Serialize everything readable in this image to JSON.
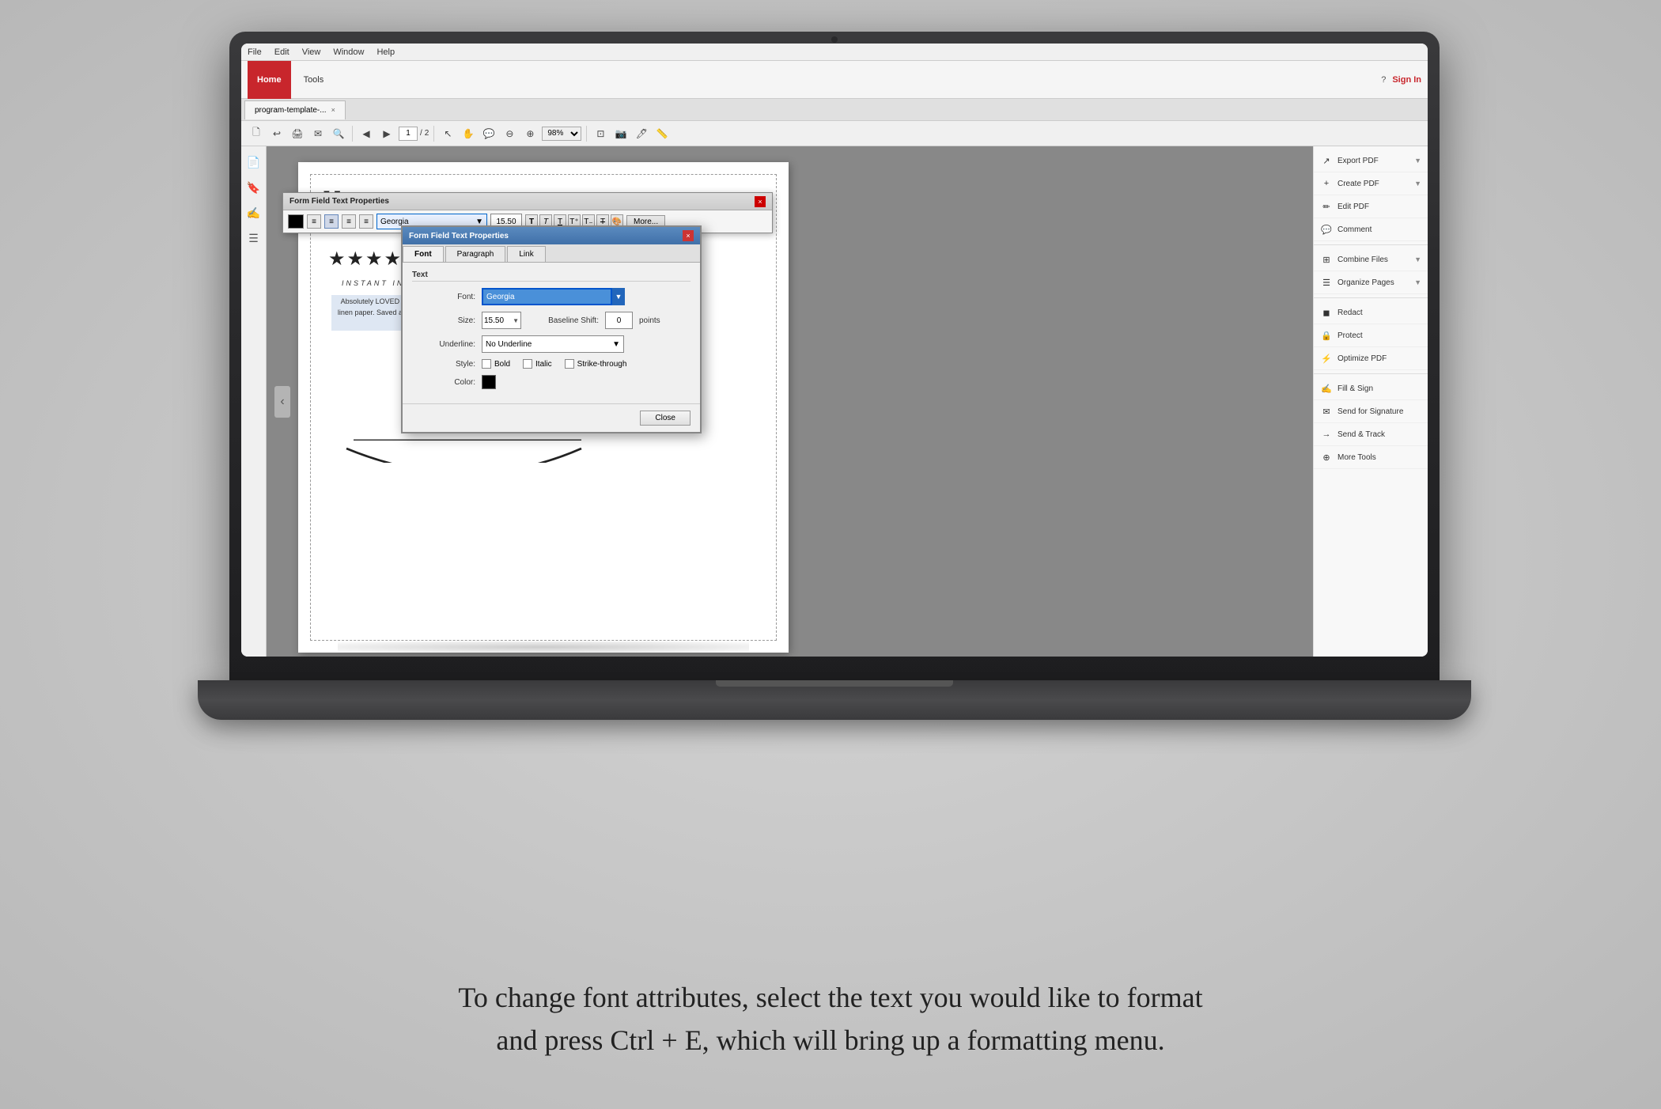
{
  "background": {
    "color": "#c8c8c8"
  },
  "menu_bar": {
    "items": [
      "File",
      "Edit",
      "View",
      "Window",
      "Help"
    ]
  },
  "ribbon": {
    "home_tab": "Home",
    "tools_tab": "Tools",
    "tab_label": "program-template-...",
    "sign_in": "Sign In",
    "help_icon": "?"
  },
  "toolbar": {
    "page_current": "1",
    "page_total": "2",
    "zoom": "98%"
  },
  "right_panel": {
    "items": [
      {
        "label": "Export PDF",
        "icon": "↗",
        "has_arrow": true
      },
      {
        "label": "Create PDF",
        "icon": "+",
        "has_arrow": true
      },
      {
        "label": "Edit PDF",
        "icon": "✏",
        "has_arrow": false
      },
      {
        "label": "Comment",
        "icon": "💬",
        "has_arrow": false
      },
      {
        "label": "Combine Files",
        "icon": "⊞",
        "has_arrow": true
      },
      {
        "label": "Organize Pages",
        "icon": "☰",
        "has_arrow": true
      },
      {
        "label": "Redact",
        "icon": "◼",
        "has_arrow": false
      },
      {
        "label": "Protect",
        "icon": "🔒",
        "has_arrow": false
      },
      {
        "label": "Optimize PDF",
        "icon": "⚡",
        "has_arrow": false
      },
      {
        "label": "Fill & Sign",
        "icon": "✍",
        "has_arrow": false
      },
      {
        "label": "Send for Signature",
        "icon": "✉",
        "has_arrow": false
      },
      {
        "label": "Send & Track",
        "icon": "→",
        "has_arrow": false
      },
      {
        "label": "More Tools",
        "icon": "⊕",
        "has_arrow": false
      }
    ]
  },
  "form_field_dialog_top": {
    "title": "Form Field Text Properties",
    "font": "Georgia",
    "size": "15.50",
    "more_btn": "More..."
  },
  "form_field_dialog_main": {
    "title": "Form Field Text Properties",
    "tabs": [
      "Font",
      "Paragraph",
      "Link"
    ],
    "active_tab": "Font",
    "text_section": "Text",
    "font_label": "Font:",
    "font_value": "Georgia",
    "size_label": "Size:",
    "size_value": "15.50",
    "baseline_label": "Baseline Shift:",
    "baseline_value": "0",
    "points_label": "points",
    "underline_label": "Underline:",
    "underline_value": "No Underline",
    "style_label": "Style:",
    "bold_label": "Bold",
    "italic_label": "Italic",
    "strikethrough_label": "Strike-through",
    "color_label": "Color:",
    "close_btn": "Close"
  },
  "pdf_content": {
    "quote_char": "““",
    "stars": "★★★★★",
    "invitation": "INSTANT INVITATION",
    "review": "Absolutely LOVED these. I bought and brought it to Staples and printed on linen paper. Saved about them printed myself only cost m recommend!! Very elegant",
    "signature": "~ M",
    "page_shadow": true
  },
  "caption": {
    "line1": "To change font attributes, select the text you would like to format",
    "line2": "and press Ctrl + E, which will bring up a formatting menu."
  }
}
